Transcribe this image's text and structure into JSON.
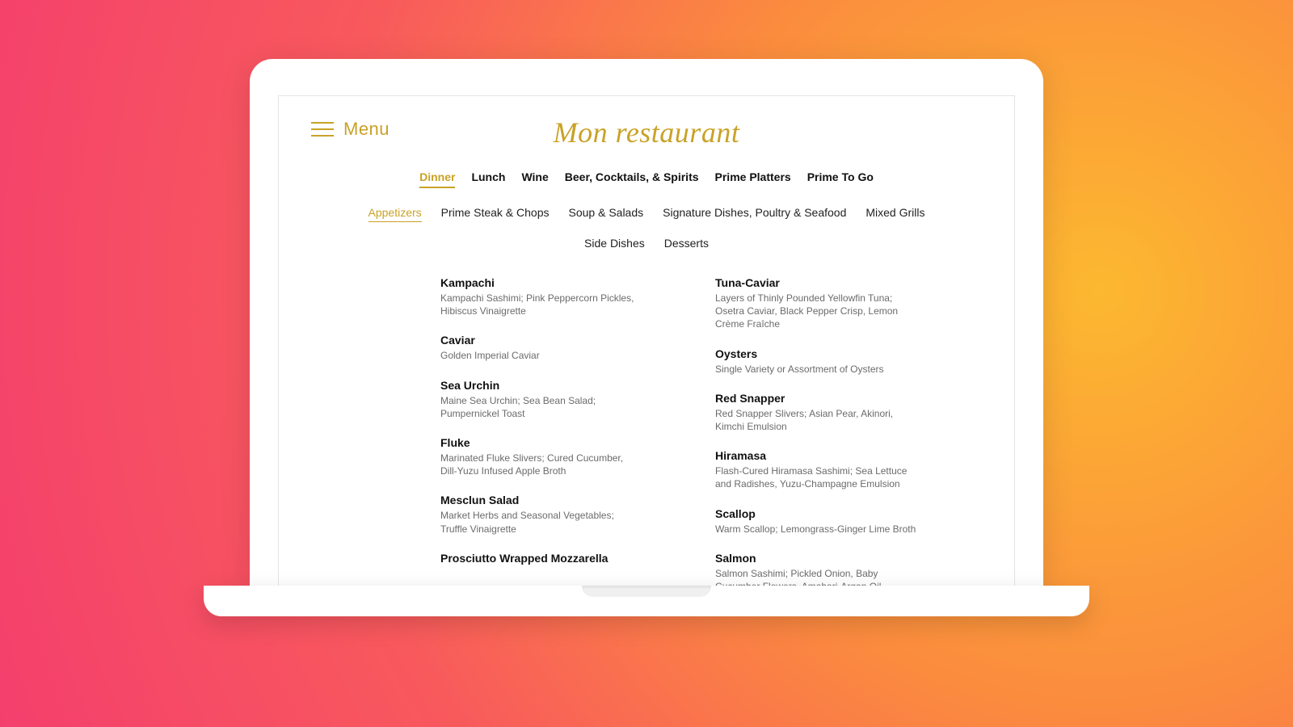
{
  "colors": {
    "accent": "#c9a227"
  },
  "header": {
    "menu_label": "Menu",
    "brand": "Mon restaurant"
  },
  "primary_nav": {
    "items": [
      {
        "label": "Dinner",
        "active": true
      },
      {
        "label": "Lunch",
        "active": false
      },
      {
        "label": "Wine",
        "active": false
      },
      {
        "label": "Beer, Cocktails, & Spirits",
        "active": false
      },
      {
        "label": "Prime Platters",
        "active": false
      },
      {
        "label": "Prime To Go",
        "active": false
      }
    ]
  },
  "sub_nav": {
    "items": [
      {
        "label": "Appetizers",
        "active": true
      },
      {
        "label": "Prime Steak & Chops",
        "active": false
      },
      {
        "label": "Soup & Salads",
        "active": false
      },
      {
        "label": "Signature Dishes, Poultry & Seafood",
        "active": false
      },
      {
        "label": "Mixed Grills",
        "active": false
      },
      {
        "label": "Side Dishes",
        "active": false
      },
      {
        "label": "Desserts",
        "active": false
      }
    ]
  },
  "menu": {
    "left": [
      {
        "name": "Kampachi",
        "desc": "Kampachi Sashimi; Pink Peppercorn Pickles, Hibiscus Vinaigrette"
      },
      {
        "name": "Caviar",
        "desc": "Golden Imperial Caviar"
      },
      {
        "name": "Sea Urchin",
        "desc": "Maine Sea Urchin; Sea Bean Salad; Pumpernickel Toast"
      },
      {
        "name": "Fluke",
        "desc": "Marinated Fluke Slivers; Cured Cucumber, Dill-Yuzu Infused Apple Broth"
      },
      {
        "name": "Mesclun Salad",
        "desc": "Market Herbs and Seasonal Vegetables; Truffle Vinaigrette"
      },
      {
        "name": "Prosciutto Wrapped Mozzarella",
        "desc": ""
      }
    ],
    "right": [
      {
        "name": "Tuna-Caviar",
        "desc": "Layers of Thinly Pounded Yellowfin Tuna; Osetra Caviar, Black Pepper Crisp, Lemon Crème Fraîche"
      },
      {
        "name": "Oysters",
        "desc": "Single Variety or Assortment of Oysters"
      },
      {
        "name": "Red Snapper",
        "desc": "Red Snapper Slivers; Asian Pear, Akinori, Kimchi Emulsion"
      },
      {
        "name": "Hiramasa",
        "desc": "Flash-Cured Hiramasa Sashimi; Sea Lettuce and Radishes, Yuzu-Champagne Emulsion"
      },
      {
        "name": "Scallop",
        "desc": "Warm Scallop; Lemongrass-Ginger Lime Broth"
      },
      {
        "name": "Salmon",
        "desc": "Salmon Sashimi; Pickled Onion, Baby Cucumber Flowers, Amahari-Argan Oil"
      }
    ]
  }
}
